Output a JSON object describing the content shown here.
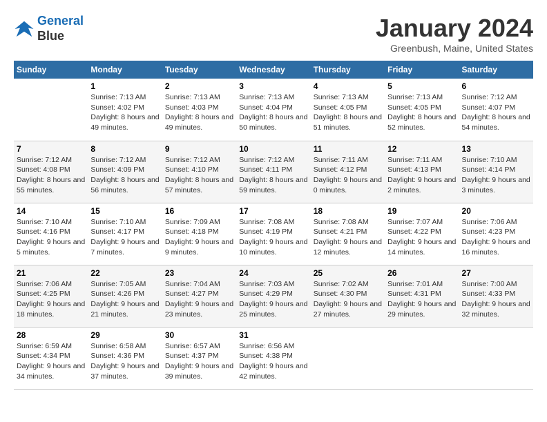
{
  "logo": {
    "line1": "General",
    "line2": "Blue"
  },
  "header": {
    "title": "January 2024",
    "location": "Greenbush, Maine, United States"
  },
  "weekdays": [
    "Sunday",
    "Monday",
    "Tuesday",
    "Wednesday",
    "Thursday",
    "Friday",
    "Saturday"
  ],
  "weeks": [
    [
      {
        "day": "",
        "sunrise": "",
        "sunset": "",
        "daylight": ""
      },
      {
        "day": "1",
        "sunrise": "Sunrise: 7:13 AM",
        "sunset": "Sunset: 4:02 PM",
        "daylight": "Daylight: 8 hours and 49 minutes."
      },
      {
        "day": "2",
        "sunrise": "Sunrise: 7:13 AM",
        "sunset": "Sunset: 4:03 PM",
        "daylight": "Daylight: 8 hours and 49 minutes."
      },
      {
        "day": "3",
        "sunrise": "Sunrise: 7:13 AM",
        "sunset": "Sunset: 4:04 PM",
        "daylight": "Daylight: 8 hours and 50 minutes."
      },
      {
        "day": "4",
        "sunrise": "Sunrise: 7:13 AM",
        "sunset": "Sunset: 4:05 PM",
        "daylight": "Daylight: 8 hours and 51 minutes."
      },
      {
        "day": "5",
        "sunrise": "Sunrise: 7:13 AM",
        "sunset": "Sunset: 4:05 PM",
        "daylight": "Daylight: 8 hours and 52 minutes."
      },
      {
        "day": "6",
        "sunrise": "Sunrise: 7:12 AM",
        "sunset": "Sunset: 4:07 PM",
        "daylight": "Daylight: 8 hours and 54 minutes."
      }
    ],
    [
      {
        "day": "7",
        "sunrise": "Sunrise: 7:12 AM",
        "sunset": "Sunset: 4:08 PM",
        "daylight": "Daylight: 8 hours and 55 minutes."
      },
      {
        "day": "8",
        "sunrise": "Sunrise: 7:12 AM",
        "sunset": "Sunset: 4:09 PM",
        "daylight": "Daylight: 8 hours and 56 minutes."
      },
      {
        "day": "9",
        "sunrise": "Sunrise: 7:12 AM",
        "sunset": "Sunset: 4:10 PM",
        "daylight": "Daylight: 8 hours and 57 minutes."
      },
      {
        "day": "10",
        "sunrise": "Sunrise: 7:12 AM",
        "sunset": "Sunset: 4:11 PM",
        "daylight": "Daylight: 8 hours and 59 minutes."
      },
      {
        "day": "11",
        "sunrise": "Sunrise: 7:11 AM",
        "sunset": "Sunset: 4:12 PM",
        "daylight": "Daylight: 9 hours and 0 minutes."
      },
      {
        "day": "12",
        "sunrise": "Sunrise: 7:11 AM",
        "sunset": "Sunset: 4:13 PM",
        "daylight": "Daylight: 9 hours and 2 minutes."
      },
      {
        "day": "13",
        "sunrise": "Sunrise: 7:10 AM",
        "sunset": "Sunset: 4:14 PM",
        "daylight": "Daylight: 9 hours and 3 minutes."
      }
    ],
    [
      {
        "day": "14",
        "sunrise": "Sunrise: 7:10 AM",
        "sunset": "Sunset: 4:16 PM",
        "daylight": "Daylight: 9 hours and 5 minutes."
      },
      {
        "day": "15",
        "sunrise": "Sunrise: 7:10 AM",
        "sunset": "Sunset: 4:17 PM",
        "daylight": "Daylight: 9 hours and 7 minutes."
      },
      {
        "day": "16",
        "sunrise": "Sunrise: 7:09 AM",
        "sunset": "Sunset: 4:18 PM",
        "daylight": "Daylight: 9 hours and 9 minutes."
      },
      {
        "day": "17",
        "sunrise": "Sunrise: 7:08 AM",
        "sunset": "Sunset: 4:19 PM",
        "daylight": "Daylight: 9 hours and 10 minutes."
      },
      {
        "day": "18",
        "sunrise": "Sunrise: 7:08 AM",
        "sunset": "Sunset: 4:21 PM",
        "daylight": "Daylight: 9 hours and 12 minutes."
      },
      {
        "day": "19",
        "sunrise": "Sunrise: 7:07 AM",
        "sunset": "Sunset: 4:22 PM",
        "daylight": "Daylight: 9 hours and 14 minutes."
      },
      {
        "day": "20",
        "sunrise": "Sunrise: 7:06 AM",
        "sunset": "Sunset: 4:23 PM",
        "daylight": "Daylight: 9 hours and 16 minutes."
      }
    ],
    [
      {
        "day": "21",
        "sunrise": "Sunrise: 7:06 AM",
        "sunset": "Sunset: 4:25 PM",
        "daylight": "Daylight: 9 hours and 18 minutes."
      },
      {
        "day": "22",
        "sunrise": "Sunrise: 7:05 AM",
        "sunset": "Sunset: 4:26 PM",
        "daylight": "Daylight: 9 hours and 21 minutes."
      },
      {
        "day": "23",
        "sunrise": "Sunrise: 7:04 AM",
        "sunset": "Sunset: 4:27 PM",
        "daylight": "Daylight: 9 hours and 23 minutes."
      },
      {
        "day": "24",
        "sunrise": "Sunrise: 7:03 AM",
        "sunset": "Sunset: 4:29 PM",
        "daylight": "Daylight: 9 hours and 25 minutes."
      },
      {
        "day": "25",
        "sunrise": "Sunrise: 7:02 AM",
        "sunset": "Sunset: 4:30 PM",
        "daylight": "Daylight: 9 hours and 27 minutes."
      },
      {
        "day": "26",
        "sunrise": "Sunrise: 7:01 AM",
        "sunset": "Sunset: 4:31 PM",
        "daylight": "Daylight: 9 hours and 29 minutes."
      },
      {
        "day": "27",
        "sunrise": "Sunrise: 7:00 AM",
        "sunset": "Sunset: 4:33 PM",
        "daylight": "Daylight: 9 hours and 32 minutes."
      }
    ],
    [
      {
        "day": "28",
        "sunrise": "Sunrise: 6:59 AM",
        "sunset": "Sunset: 4:34 PM",
        "daylight": "Daylight: 9 hours and 34 minutes."
      },
      {
        "day": "29",
        "sunrise": "Sunrise: 6:58 AM",
        "sunset": "Sunset: 4:36 PM",
        "daylight": "Daylight: 9 hours and 37 minutes."
      },
      {
        "day": "30",
        "sunrise": "Sunrise: 6:57 AM",
        "sunset": "Sunset: 4:37 PM",
        "daylight": "Daylight: 9 hours and 39 minutes."
      },
      {
        "day": "31",
        "sunrise": "Sunrise: 6:56 AM",
        "sunset": "Sunset: 4:38 PM",
        "daylight": "Daylight: 9 hours and 42 minutes."
      },
      {
        "day": "",
        "sunrise": "",
        "sunset": "",
        "daylight": ""
      },
      {
        "day": "",
        "sunrise": "",
        "sunset": "",
        "daylight": ""
      },
      {
        "day": "",
        "sunrise": "",
        "sunset": "",
        "daylight": ""
      }
    ]
  ]
}
